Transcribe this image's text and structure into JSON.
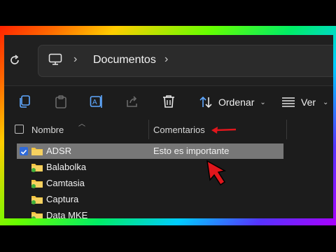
{
  "address_bar": {
    "refresh_icon": "refresh-icon",
    "location_icon": "computer-icon",
    "breadcrumb": "Documentos"
  },
  "toolbar": {
    "sort_label": "Ordenar",
    "view_label": "Ver",
    "icons": [
      "copy-icon",
      "paste-icon",
      "rename-icon",
      "share-icon",
      "delete-icon",
      "sort-icon",
      "view-icon"
    ]
  },
  "columns": {
    "name": "Nombre",
    "comments": "Comentarios"
  },
  "files": [
    {
      "name": "ADSR",
      "comment": "Esto es importante",
      "selected": true,
      "checked": true
    },
    {
      "name": "Balabolka",
      "comment": "",
      "selected": false,
      "checked": false
    },
    {
      "name": "Camtasia",
      "comment": "",
      "selected": false,
      "checked": false
    },
    {
      "name": "Captura",
      "comment": "",
      "selected": false,
      "checked": false
    },
    {
      "name": "Data MKE",
      "comment": "",
      "selected": false,
      "checked": false
    }
  ],
  "colors": {
    "window_bg": "#1c1c1c",
    "selection": "#777777",
    "checkbox_accent": "#2f6ad9",
    "folder": "#f3c542",
    "sync_badge": "#3fae3a",
    "annotation_red": "#e0161c"
  }
}
